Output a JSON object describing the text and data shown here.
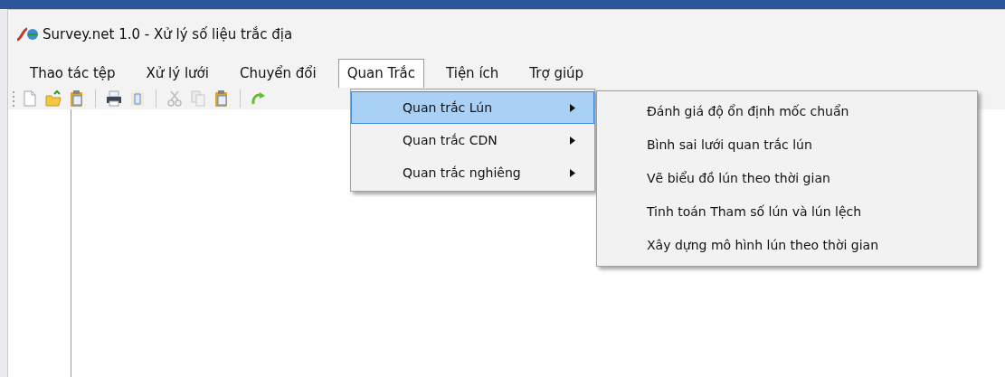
{
  "window": {
    "title": "Survey.net 1.0 - Xử lý số liệu trắc địa"
  },
  "menu_bar": [
    {
      "label": "Thao tác tệp",
      "selected": false
    },
    {
      "label": "Xử lý lưới",
      "selected": false
    },
    {
      "label": "Chuyển đổi",
      "selected": false
    },
    {
      "label": "Quan Trắc",
      "selected": true
    },
    {
      "label": "Tiện ích",
      "selected": false
    },
    {
      "label": "Trợ giúp",
      "selected": false
    }
  ],
  "toolbar": [
    {
      "kind": "new",
      "disabled": false
    },
    {
      "kind": "open",
      "disabled": false
    },
    {
      "kind": "clipboard",
      "disabled": false
    },
    {
      "kind": "separator",
      "disabled": false
    },
    {
      "kind": "print",
      "disabled": false
    },
    {
      "kind": "preview",
      "disabled": false
    },
    {
      "kind": "separator",
      "disabled": false
    },
    {
      "kind": "cut",
      "disabled": true
    },
    {
      "kind": "copy",
      "disabled": true
    },
    {
      "kind": "paste",
      "disabled": false
    },
    {
      "kind": "separator",
      "disabled": false
    },
    {
      "kind": "redo",
      "disabled": false
    }
  ],
  "dropdown": [
    {
      "label": "Quan trắc Lún",
      "selected": true,
      "submenu": true
    },
    {
      "label": "Quan trắc CDN",
      "selected": false,
      "submenu": true
    },
    {
      "label": "Quan trắc nghiêng",
      "selected": false,
      "submenu": true
    }
  ],
  "submenu": [
    {
      "label": "Đánh giá độ ổn định mốc chuẩn"
    },
    {
      "label": "Bình sai lưới quan trắc lún"
    },
    {
      "label": "Vẽ biểu đồ lún theo thời gian"
    },
    {
      "label": "Tinh toán Tham số lún và lún lệch"
    },
    {
      "label": "Xây dựng mô hình lún theo thời gian"
    }
  ]
}
